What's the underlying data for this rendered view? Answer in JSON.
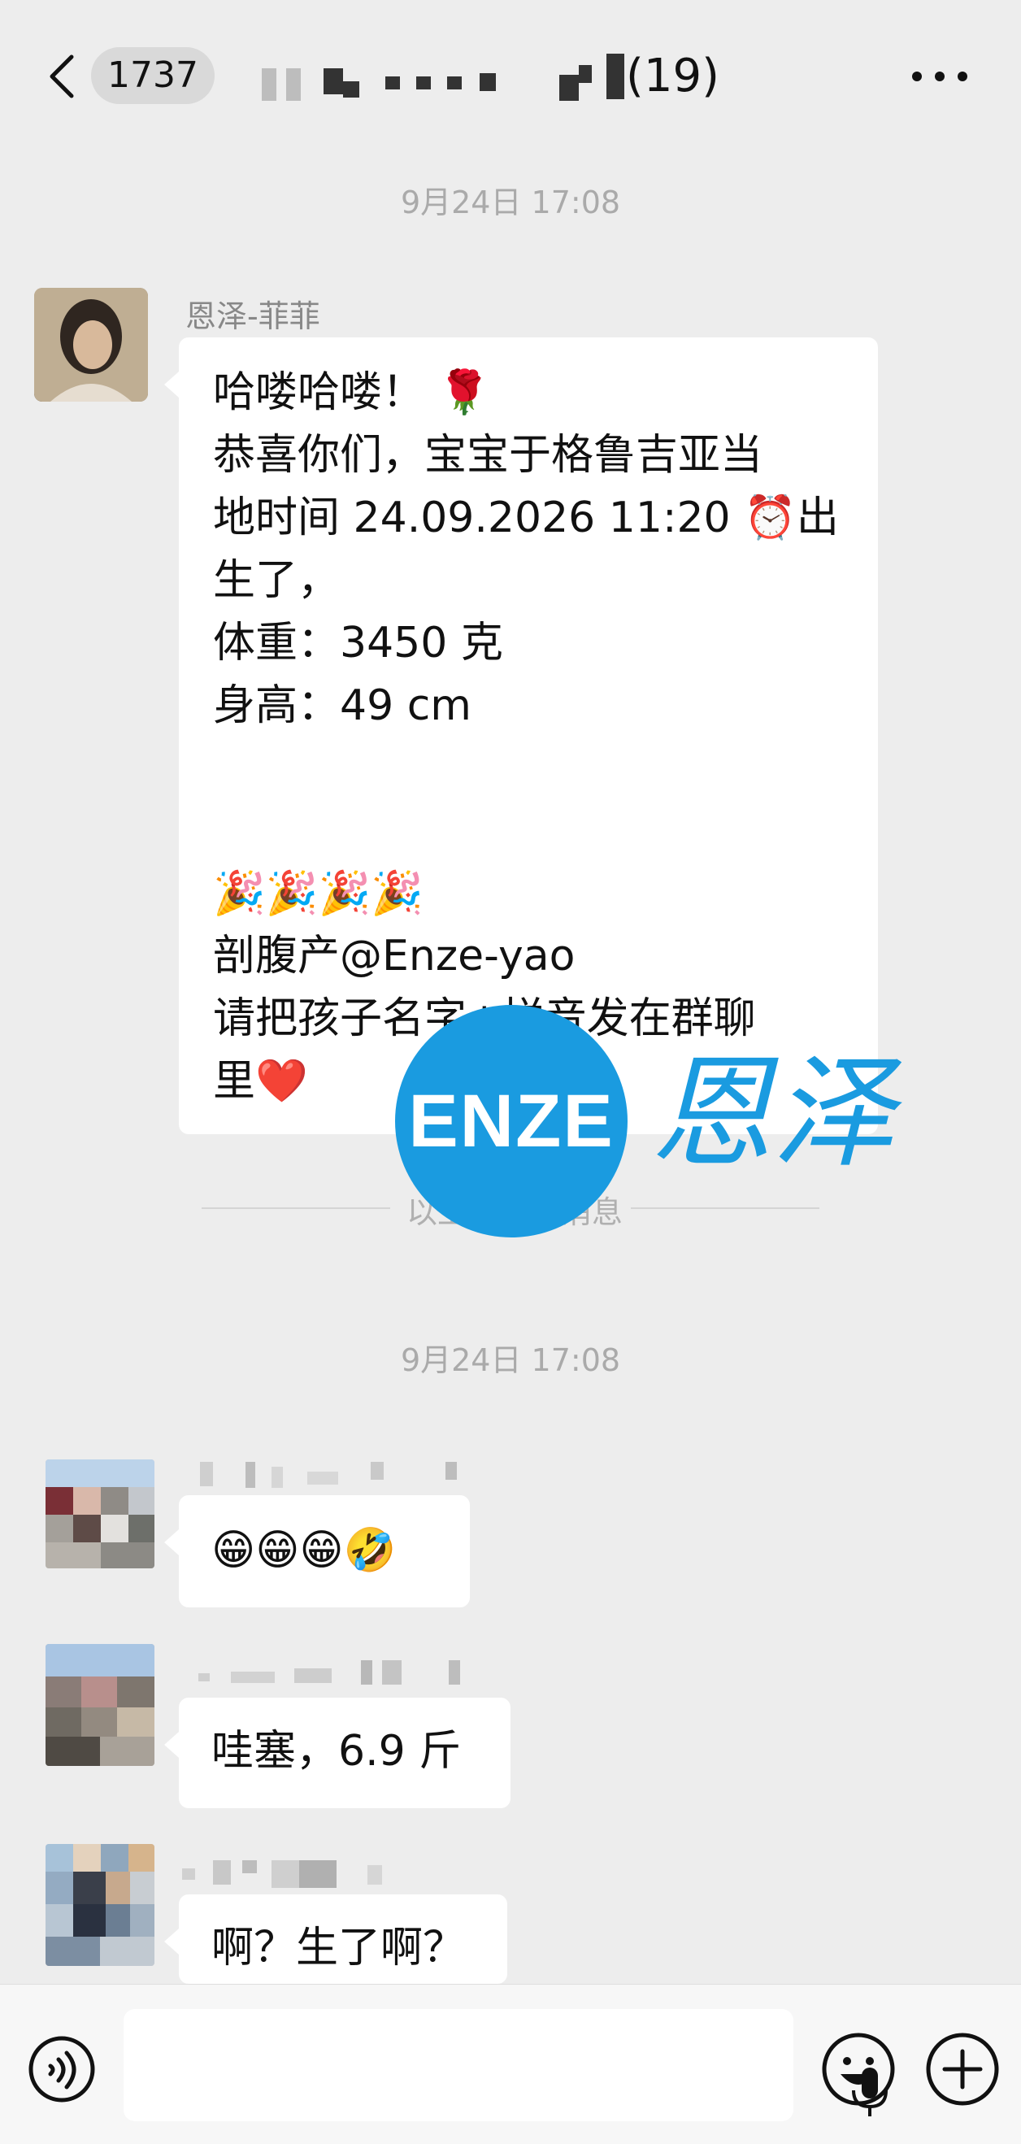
{
  "header": {
    "unread_count": "1737",
    "member_count": "(19)"
  },
  "messages": {
    "timestamp_1": "9月24日 17:08",
    "sender_1": "恩泽-菲菲",
    "announcement_lines": [
      "哈喽哈喽！ 🌹",
      "恭喜你们，宝宝于格鲁吉亚当",
      "地时间 24.09.2026 11:20 ⏰出",
      "生了，",
      "体重：3450 克",
      "身高：49 cm",
      "",
      "",
      "🎉🎉🎉🎉",
      "剖腹产@Enze-yao",
      "请把孩子名字+拼音发在群聊",
      "里❤️"
    ],
    "divider_text": "以上为历史消息",
    "divider_visible_left": "以",
    "divider_visible_right": "息",
    "timestamp_2": "9月24日 17:08",
    "reply_1": "😁😁😁🤣",
    "reply_2": "哇塞，6.9 斤",
    "reply_3": "啊？生了啊？"
  },
  "watermark": {
    "logo_text": "ENZE",
    "chinese_text": "恩泽"
  },
  "colors": {
    "background": "#ededed",
    "bubble": "#ffffff",
    "watermark_blue": "#1a9be0",
    "timestamp_gray": "#aaaaaa"
  },
  "icons": [
    "chevron-left-icon",
    "more-icon",
    "voice-toggle-icon",
    "mic-icon",
    "emoji-icon",
    "plus-icon"
  ]
}
